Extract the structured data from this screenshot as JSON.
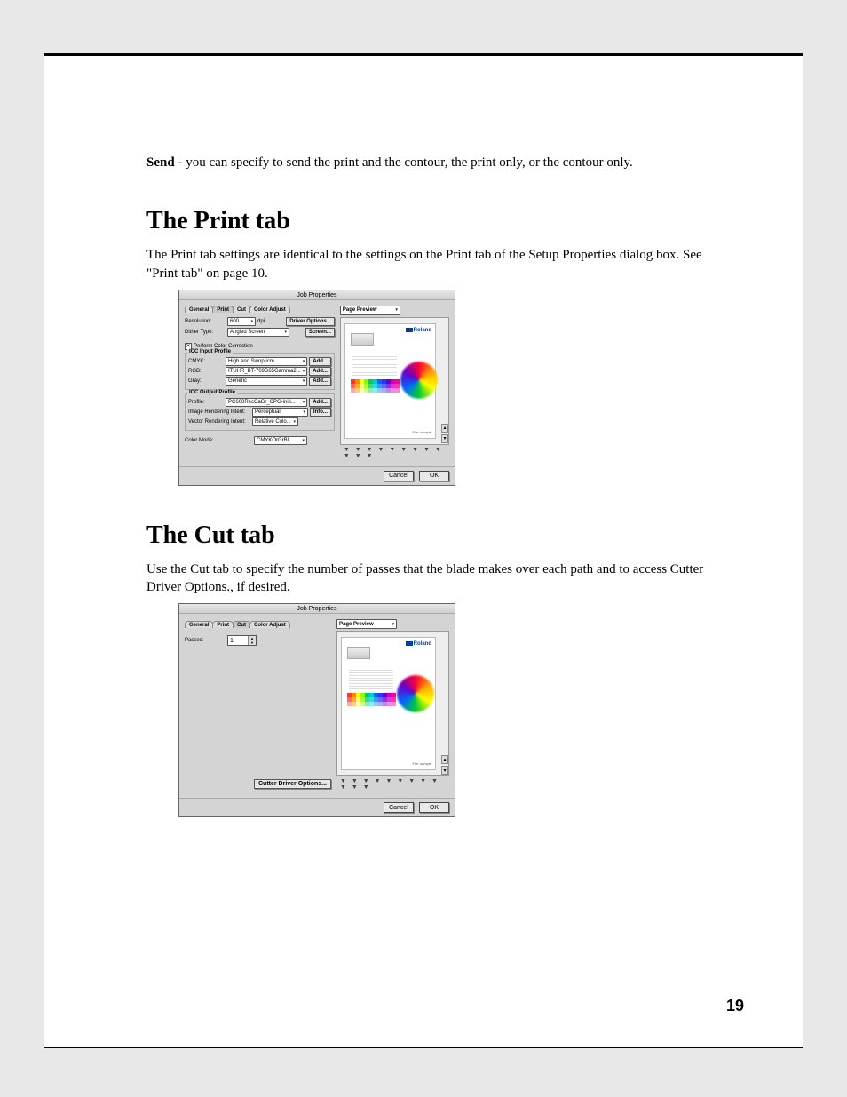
{
  "intro": {
    "send_label": "Send - ",
    "send_body": "you can specify to send the print and the contour, the print only, or the contour only."
  },
  "print": {
    "heading": "The Print tab",
    "para": "The Print tab settings are identical to the settings on the Print tab of the Setup Properties dialog box. See \"Print tab\" on page 10."
  },
  "cut": {
    "heading": "The Cut tab",
    "para": "Use the Cut tab to specify the number of passes that the blade makes over each path and to access Cutter Driver Options., if desired."
  },
  "dlg": {
    "title": "Job Properties",
    "tabs": [
      "General",
      "Print",
      "Cut",
      "Color Adjust"
    ],
    "page_preview_label": "Page Preview",
    "brand": "Roland",
    "cancel": "Cancel",
    "ok": "OK",
    "print": {
      "res_label": "Resolution:",
      "res_val": "600",
      "dpi": "dpi",
      "driver_opts": "Driver Options...",
      "dither_label": "Dither Type:",
      "dither_val": "Angled Screen",
      "screen_btn": "Screen...",
      "perform_cc": "Perform Color Correction",
      "icc_input": "ICC Input Profile",
      "cmyk_label": "CMYK:",
      "cmyk_val": "High end Swop.icm",
      "rgb_label": "RGB:",
      "rgb_val": "ITUHR_BT-709D65Gamma2...",
      "gray_label": "Gray:",
      "gray_val": "Generic",
      "add_btn": "Add...",
      "icc_output": "ICC Output Profile",
      "profile_label": "Profile:",
      "profile_val": "PC600RecCaGr_CPG-initi...",
      "img_intent_label": "Image Rendering Intent:",
      "img_intent_val": "Perceptual",
      "info_btn": "Info...",
      "vec_intent_label": "Vector Rendering Intent:",
      "vec_intent_val": "Relative Colo...",
      "color_mode_label": "Color Mode:",
      "color_mode_val": "CMYKOrGrBl"
    },
    "cut": {
      "passes_label": "Passes:",
      "passes_val": "1",
      "cut_opts": "Cutter Driver Options..."
    },
    "preview_note": "File: sample"
  },
  "page_number": "19"
}
